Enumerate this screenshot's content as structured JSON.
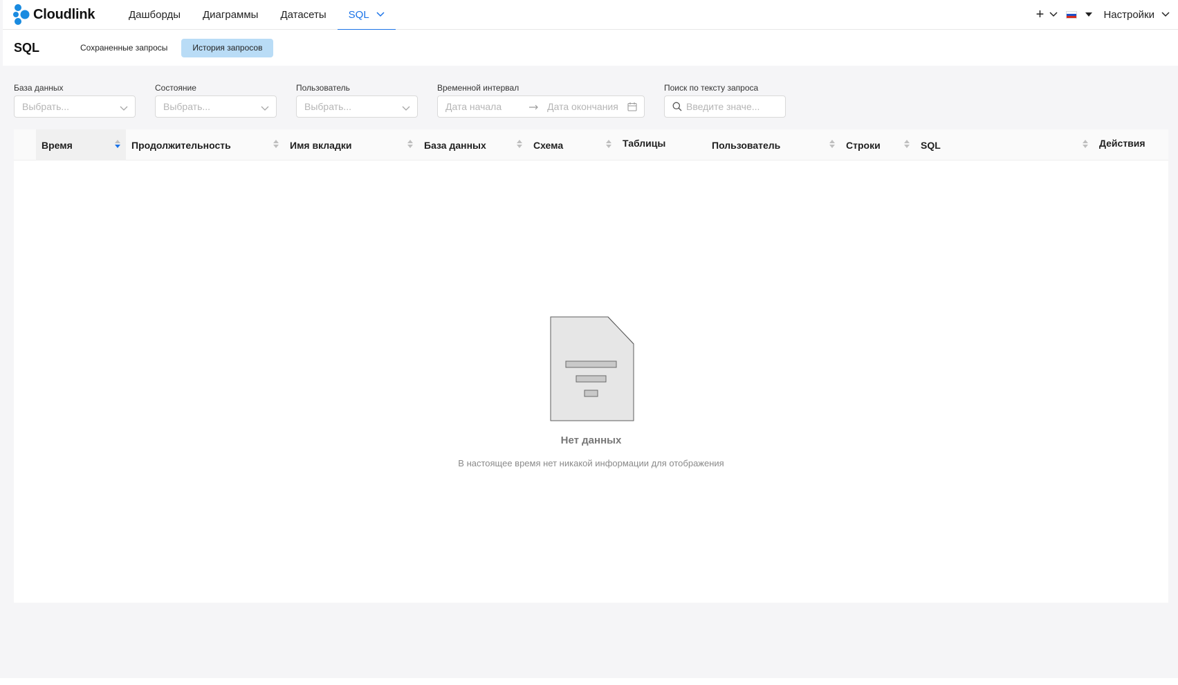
{
  "app": {
    "brand": "Cloudlink",
    "brand_color": "#1a8be0",
    "accent_color": "#1a73e8"
  },
  "nav": {
    "items": [
      {
        "label": "Дашборды"
      },
      {
        "label": "Диаграммы"
      },
      {
        "label": "Датасеты"
      },
      {
        "label": "SQL",
        "active": true
      }
    ],
    "plus_label": "+",
    "settings_label": "Настройки",
    "language_flag": "ru-flag-icon"
  },
  "subheader": {
    "title": "SQL",
    "tabs": [
      {
        "label": "Сохраненные запросы",
        "active": false
      },
      {
        "label": "История запросов",
        "active": true
      }
    ]
  },
  "filters": {
    "database": {
      "label": "База данных",
      "placeholder": "Выбрать..."
    },
    "state": {
      "label": "Состояние",
      "placeholder": "Выбрать..."
    },
    "user": {
      "label": "Пользователь",
      "placeholder": "Выбрать..."
    },
    "interval": {
      "label": "Временной интервал",
      "start_placeholder": "Дата начала",
      "end_placeholder": "Дата окончания"
    },
    "search": {
      "label": "Поиск по тексту запроса",
      "placeholder": "Введите значе..."
    }
  },
  "table": {
    "columns": [
      {
        "label": "Время",
        "sortable": true,
        "sorted": "desc"
      },
      {
        "label": "Продолжительность",
        "sortable": true
      },
      {
        "label": "Имя вкладки",
        "sortable": true
      },
      {
        "label": "База данных",
        "sortable": true
      },
      {
        "label": "Схема",
        "sortable": true
      },
      {
        "label": "Таблицы",
        "sortable": false
      },
      {
        "label": "Пользователь",
        "sortable": true
      },
      {
        "label": "Строки",
        "sortable": true
      },
      {
        "label": "SQL",
        "sortable": true
      },
      {
        "label": "Действия",
        "sortable": false
      }
    ],
    "rows": [],
    "empty": {
      "title": "Нет данных",
      "description": "В настоящее время нет никакой информации для отображения"
    }
  }
}
